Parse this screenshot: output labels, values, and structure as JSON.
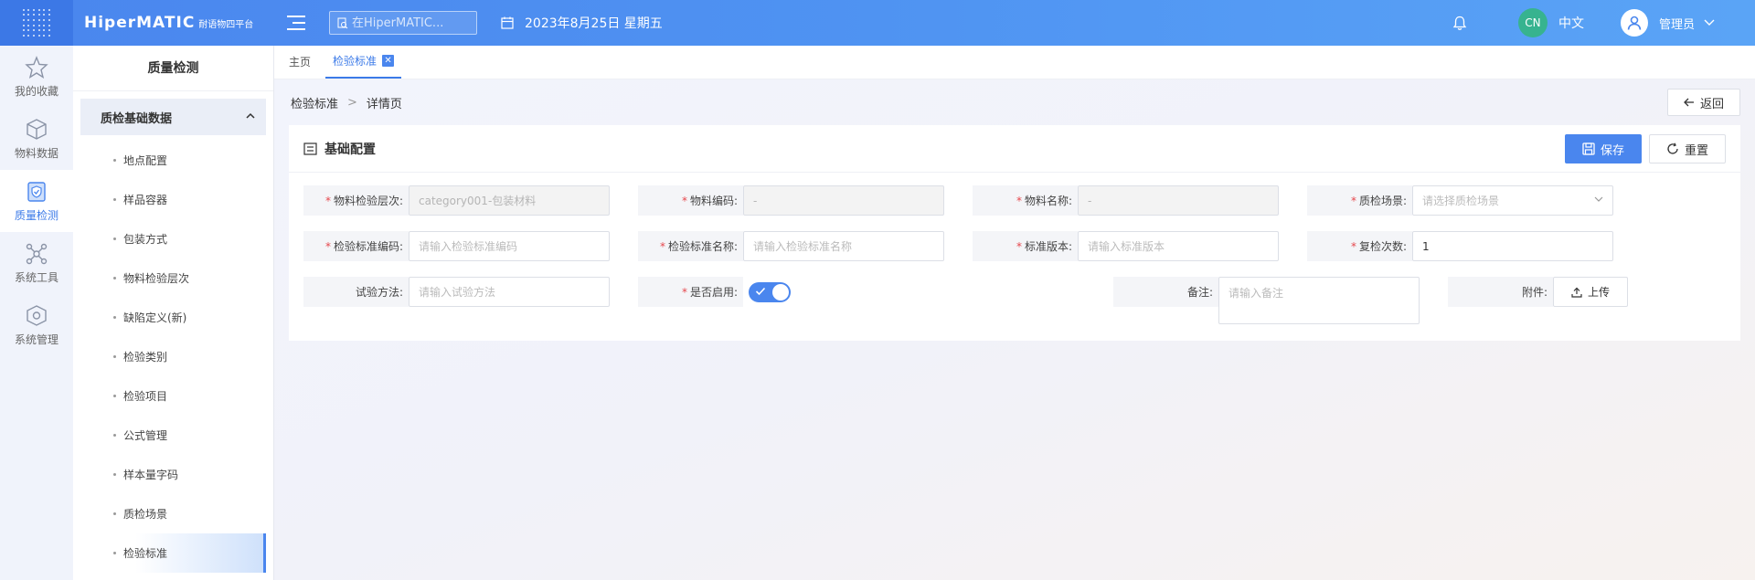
{
  "header": {
    "brand_main": "HiperMATIC",
    "brand_sub": "耐语物四平台",
    "search_placeholder": "在HiperMATIC...",
    "date": "2023年8月25日 星期五",
    "lang_badge": "CN",
    "lang_label": "中文",
    "user_label": "管理员"
  },
  "rail": {
    "items": [
      {
        "label": "我的收藏",
        "icon": "star-icon"
      },
      {
        "label": "物料数据",
        "icon": "cube-icon"
      },
      {
        "label": "质量检测",
        "icon": "shield-check-icon",
        "active": true
      },
      {
        "label": "系统工具",
        "icon": "network-icon"
      },
      {
        "label": "系统管理",
        "icon": "gear-cube-icon"
      }
    ]
  },
  "subnav": {
    "title": "质量检测",
    "group": "质检基础数据",
    "items": [
      "地点配置",
      "样品容器",
      "包装方式",
      "物料检验层次",
      "缺陷定义(新)",
      "检验类别",
      "检验项目",
      "公式管理",
      "样本量字码",
      "质检场景",
      "检验标准"
    ]
  },
  "tabs": [
    "主页",
    "检验标准"
  ],
  "breadcrumb": {
    "first": "检验标准",
    "sep": ">",
    "second": "详情页"
  },
  "back_label": "返回",
  "panel": {
    "title": "基础配置",
    "save_label": "保存",
    "reset_label": "重置"
  },
  "form": {
    "row1": [
      {
        "label": "物料检验层次:",
        "value": "category001-包装材料",
        "required": true
      },
      {
        "label": "物料编码:",
        "value": "-",
        "required": true
      },
      {
        "label": "物料名称:",
        "value": "-",
        "required": true
      },
      {
        "label": "质检场景:",
        "placeholder": "请选择质检场景",
        "required": true
      }
    ],
    "row2": [
      {
        "label": "检验标准编码:",
        "placeholder": "请输入检验标准编码",
        "required": true
      },
      {
        "label": "检验标准名称:",
        "placeholder": "请输入检验标准名称",
        "required": true
      },
      {
        "label": "标准版本:",
        "placeholder": "请输入标准版本",
        "required": true
      },
      {
        "label": "复检次数:",
        "value": "1",
        "required": true
      }
    ],
    "row3": [
      {
        "label": "试验方法:",
        "placeholder": "请输入试验方法",
        "required": false
      },
      {
        "label": "是否启用:",
        "enabled": true,
        "required": true
      },
      {
        "label": "备注:",
        "placeholder": "请输入备注",
        "required": false
      },
      {
        "label": "附件:",
        "button": "上传",
        "required": false
      }
    ]
  },
  "colors": {
    "accent": "#4a86ee",
    "required": "#e5484d",
    "lang_badge": "#37b38f"
  }
}
